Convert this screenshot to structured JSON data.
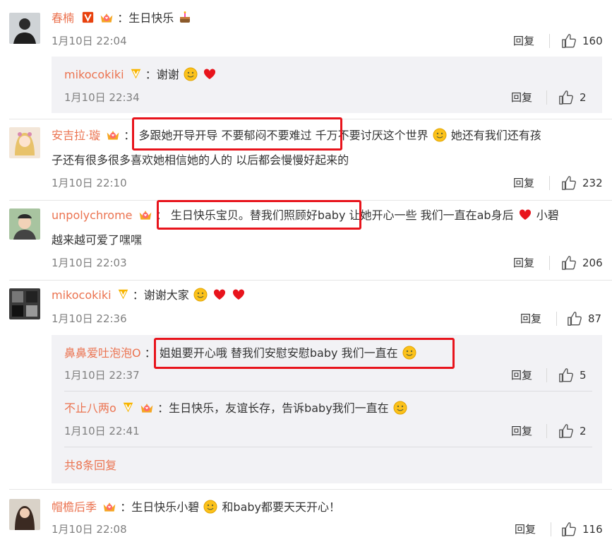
{
  "comments": [
    {
      "user": "春楠",
      "text": "：生日快乐",
      "time": "1月10日 22:04",
      "reply": "回复",
      "likes": "160",
      "replies": [
        {
          "user": "mikocokiki",
          "text": "：谢谢",
          "time": "1月10日 22:34",
          "reply": "回复",
          "likes": "2"
        }
      ]
    },
    {
      "user": "安吉拉·璇",
      "text_line1_a": "：",
      "text_line1_boxed": "多跟她开导开导  不要郁闷不要难过",
      "text_line1_b": " 千万不要讨厌这个世界",
      "text_line1_c": "她还有我们还有孩",
      "text_line2": "子还有很多很多喜欢她相信她的人的  以后都会慢慢好起来的",
      "time": "1月10日 22:10",
      "reply": "回复",
      "likes": "232"
    },
    {
      "user": "unpolychrome",
      "text_line1_a": "：",
      "text_line1_boxed": "生日快乐宝贝。替我们照顾好baby",
      "text_line1_b": "让她开心一些 我们一直在ab身后",
      "text_line1_c": " 小碧",
      "text_line2": "越来越可爱了嘿嘿",
      "time": "1月10日 22:03",
      "reply": "回复",
      "likes": "206"
    },
    {
      "user": "mikocokiki",
      "text": "：谢谢大家",
      "time": "1月10日 22:36",
      "reply": "回复",
      "likes": "87",
      "replies": [
        {
          "user": "鼻鼻爱吐泡泡O",
          "text_a": "：",
          "text_boxed": "姐姐要开心哦 替我们安慰安慰baby 我们一直在",
          "time": "1月10日 22:37",
          "reply": "回复",
          "likes": "5"
        },
        {
          "user": "不止八两o",
          "text": "：生日快乐，友谊长存，告诉baby我们一直在",
          "time": "1月10日 22:41",
          "reply": "回复",
          "likes": "2"
        }
      ],
      "more_replies": "共8条回复"
    },
    {
      "user": "帽檐后季",
      "text_a": "：生日快乐小碧",
      "text_b": "和baby都要天天开心！",
      "time": "1月10日 22:08",
      "reply": "回复",
      "likes": "116"
    }
  ],
  "icons": {
    "verified_badge": "verified-v-badge",
    "vip_crown": "crown-badge",
    "like": "thumbs-up-icon"
  },
  "colors": {
    "username": "#eb7350",
    "highlight_box": "#e8141c",
    "reply_background": "#f2f2f5"
  }
}
